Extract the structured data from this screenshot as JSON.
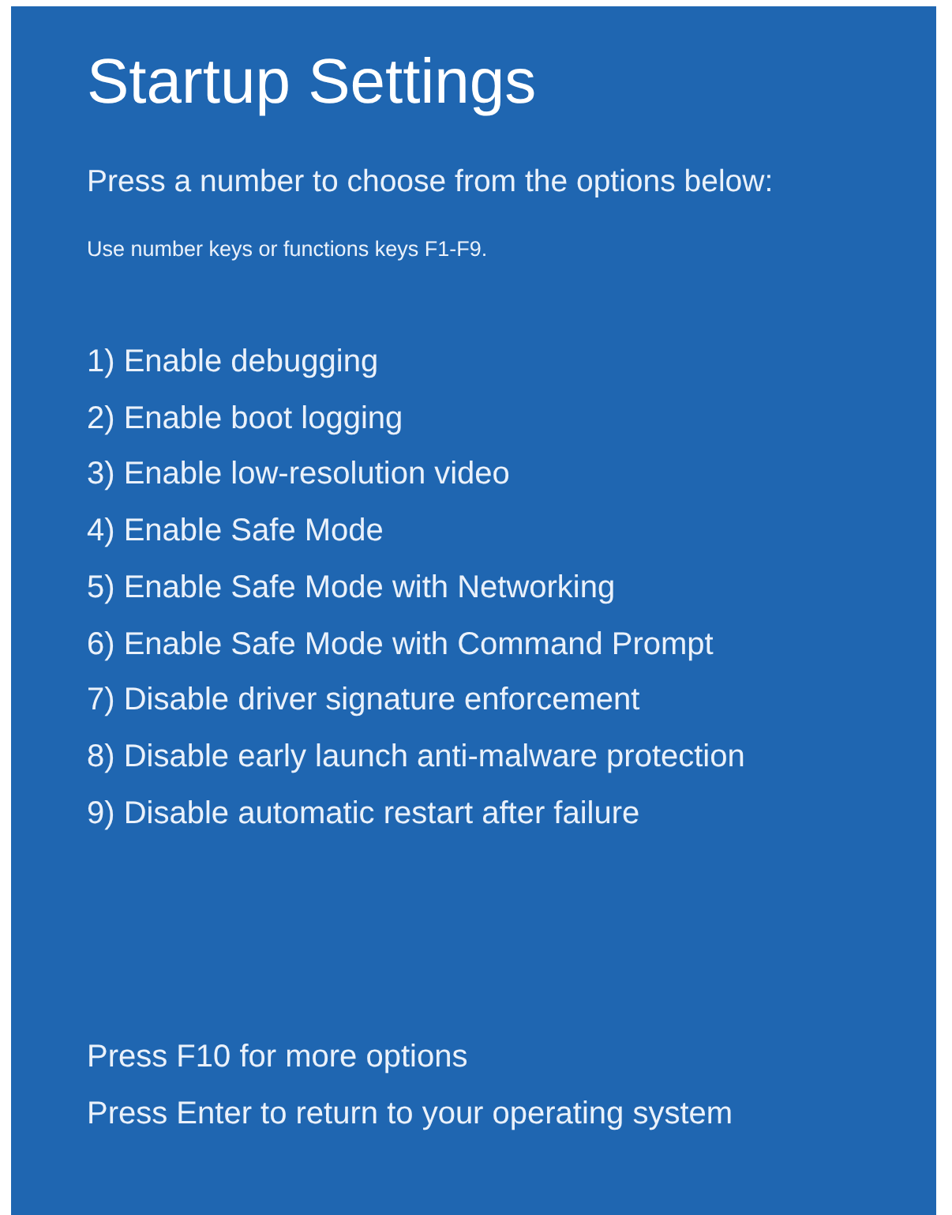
{
  "title": "Startup Settings",
  "prompt": "Press a number to choose from the options below:",
  "hint": "Use number keys or functions keys F1-F9.",
  "options": [
    "1) Enable debugging",
    "2) Enable boot logging",
    "3) Enable low-resolution video",
    "4) Enable Safe Mode",
    "5) Enable Safe Mode with Networking",
    "6) Enable Safe Mode with Command Prompt",
    "7) Disable driver signature enforcement",
    "8) Disable early launch anti-malware protection",
    "9) Disable automatic restart after failure"
  ],
  "footer": [
    "Press F10 for more options",
    "Press Enter to return to your operating system"
  ]
}
